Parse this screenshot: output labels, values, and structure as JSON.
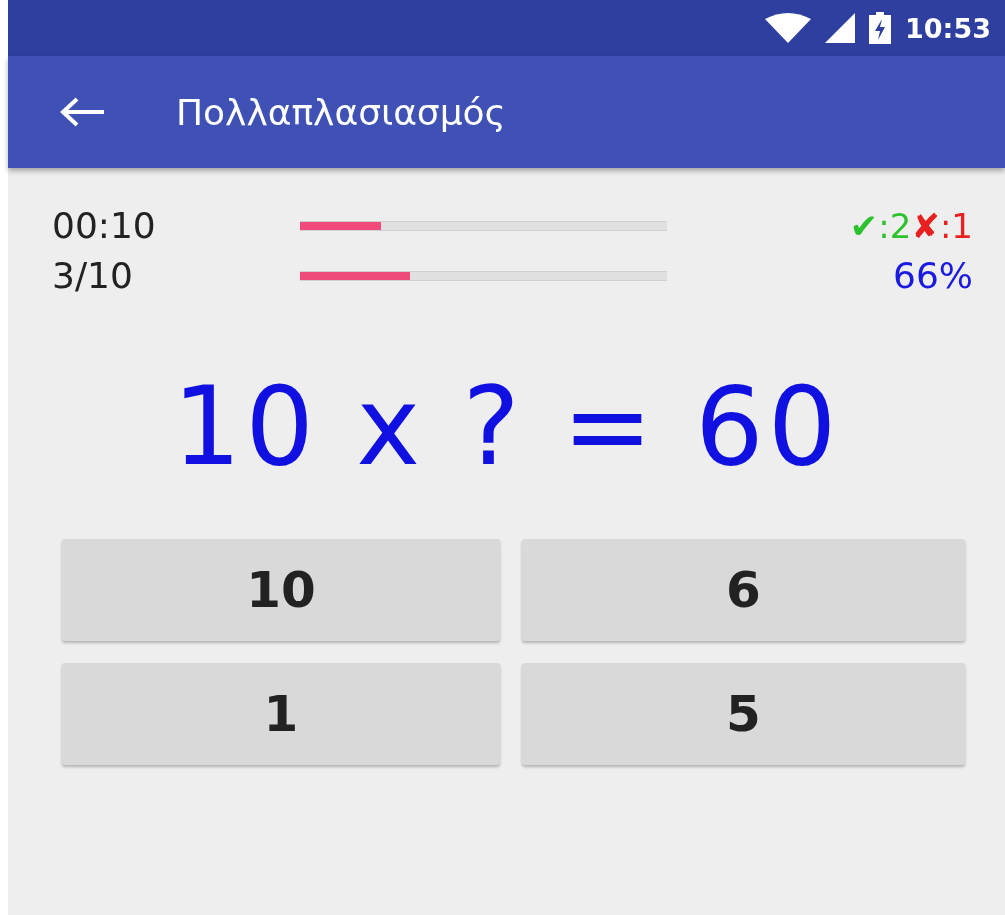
{
  "status_bar": {
    "time": "10:53"
  },
  "app_bar": {
    "title": "Πολλαπλασιασμός"
  },
  "timer": {
    "text": "00:10",
    "level": 0.22
  },
  "progress": {
    "text": "3/10",
    "level": 0.3
  },
  "score": {
    "correct_icon": "✔",
    "correct": ":2",
    "wrong_icon": "✘",
    "wrong": ":1",
    "percent": "66%"
  },
  "question": "10 x ? = 60",
  "answers": [
    {
      "label": "10"
    },
    {
      "label": "6"
    },
    {
      "label": "1"
    },
    {
      "label": "5"
    }
  ]
}
